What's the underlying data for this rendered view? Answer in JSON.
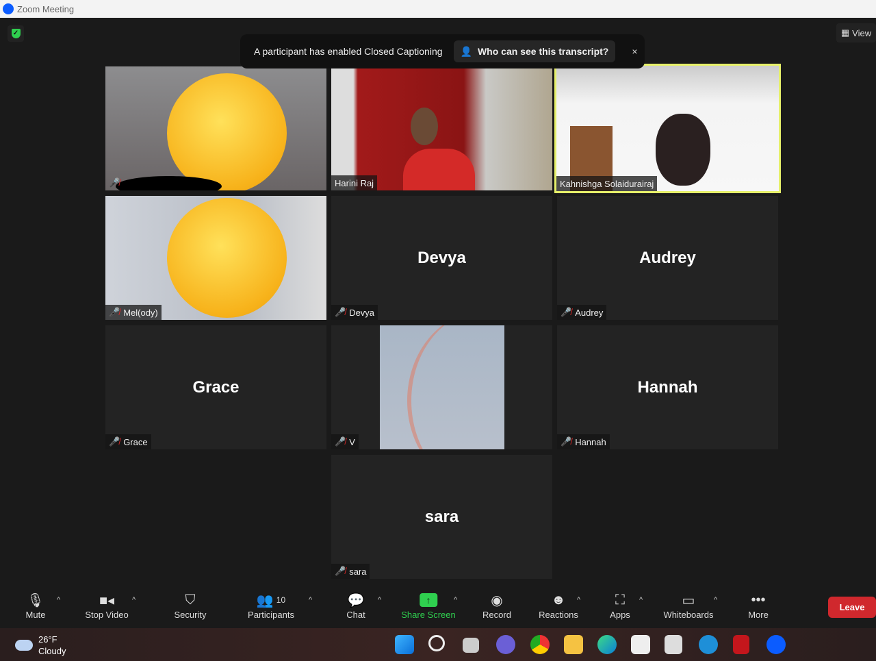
{
  "window": {
    "title": "Zoom Meeting"
  },
  "header": {
    "view_label": "View"
  },
  "banner": {
    "message": "A participant has enabled Closed Captioning",
    "link": "Who can see this transcript?",
    "close": "×"
  },
  "tiles": [
    {
      "name": "",
      "big": ""
    },
    {
      "name": "Harini Raj",
      "big": ""
    },
    {
      "name": "Kahnishga Solaidurairaj",
      "big": ""
    },
    {
      "name": "Mel(ody)",
      "big": ""
    },
    {
      "name": "Devya",
      "big": "Devya"
    },
    {
      "name": "Audrey",
      "big": "Audrey"
    },
    {
      "name": "Grace",
      "big": "Grace"
    },
    {
      "name": "V",
      "big": ""
    },
    {
      "name": "Hannah",
      "big": "Hannah"
    },
    {
      "name": "sara",
      "big": "sara"
    }
  ],
  "toolbar": {
    "mute": "Mute",
    "video": "Stop Video",
    "security": "Security",
    "participants": "Participants",
    "participant_count": "10",
    "chat": "Chat",
    "share": "Share Screen",
    "record": "Record",
    "reactions": "Reactions",
    "apps": "Apps",
    "whiteboards": "Whiteboards",
    "more": "More",
    "leave": "Leave"
  },
  "taskbar": {
    "temp": "26°F",
    "condition": "Cloudy"
  },
  "colors": {
    "accent_green": "#2fcf4f",
    "leave_red": "#d0282d",
    "active_speaker": "#e6f06a"
  }
}
